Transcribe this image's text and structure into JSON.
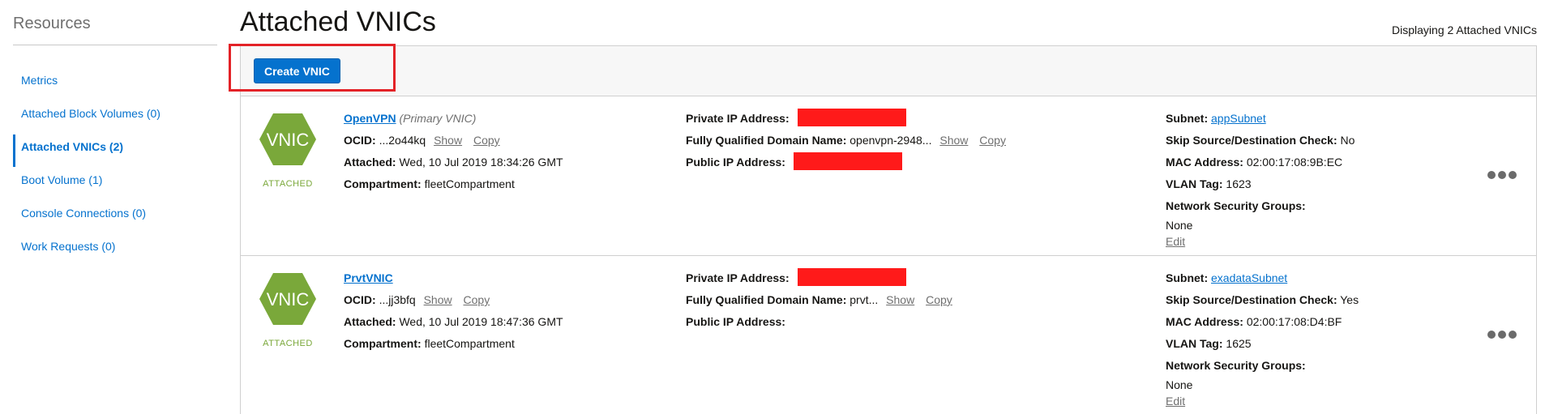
{
  "sidebar": {
    "title": "Resources",
    "items": [
      {
        "label": "Metrics"
      },
      {
        "label": "Attached Block Volumes (0)"
      },
      {
        "label": "Attached VNICs (2)"
      },
      {
        "label": "Boot Volume (1)"
      },
      {
        "label": "Console Connections (0)"
      },
      {
        "label": "Work Requests (0)"
      }
    ],
    "active_index": 2
  },
  "main": {
    "title": "Attached VNICs",
    "display_count": "Displaying 2 Attached VNICs",
    "create_button": "Create VNIC"
  },
  "labels": {
    "ocid": "OCID:",
    "attached": "Attached:",
    "compartment": "Compartment:",
    "private_ip": "Private IP Address:",
    "fqdn": "Fully Qualified Domain Name:",
    "public_ip": "Public IP Address:",
    "subnet": "Subnet:",
    "skip_check": "Skip Source/Destination Check:",
    "mac": "MAC Address:",
    "vlan": "VLAN Tag:",
    "nsg": "Network Security Groups:",
    "show": "Show",
    "copy": "Copy",
    "edit": "Edit"
  },
  "vnics": [
    {
      "icon_text": "VNIC",
      "state": "ATTACHED",
      "name": "OpenVPN",
      "primary_tag": "(Primary VNIC)",
      "ocid": "...2o44kq",
      "attached": "Wed, 10 Jul 2019 18:34:26 GMT",
      "compartment": "fleetCompartment",
      "fqdn": "openvpn-2948...",
      "public_ip_redacted": true,
      "subnet": "appSubnet",
      "skip_check": "No",
      "mac": "02:00:17:08:9B:EC",
      "vlan": "1623",
      "nsg": "None"
    },
    {
      "icon_text": "VNIC",
      "state": "ATTACHED",
      "name": "PrvtVNIC",
      "primary_tag": "",
      "ocid": "...jj3bfq",
      "attached": "Wed, 10 Jul 2019 18:47:36 GMT",
      "compartment": "fleetCompartment",
      "fqdn": "prvt...",
      "public_ip_redacted": false,
      "subnet": "exadataSubnet",
      "skip_check": "Yes",
      "mac": "02:00:17:08:D4:BF",
      "vlan": "1625",
      "nsg": "None"
    }
  ],
  "colors": {
    "accent": "#0572ce",
    "attached_green": "#7aa83a",
    "redaction": "#ff1a1a",
    "highlight": "#e32227"
  }
}
